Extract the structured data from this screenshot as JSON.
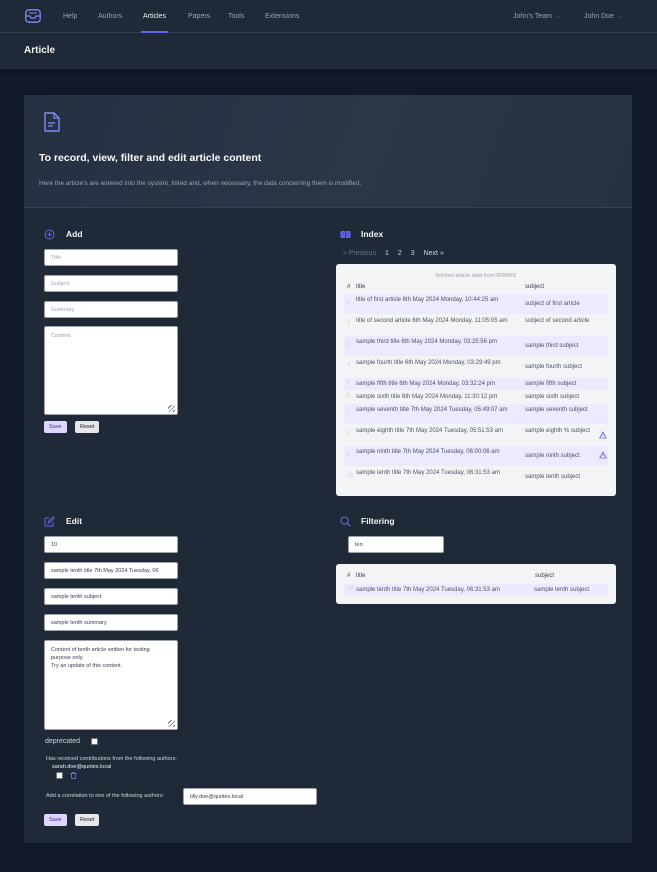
{
  "nav": {
    "items": [
      "Help",
      "Authors",
      "Articles",
      "Papers",
      "Tools",
      "Extensions"
    ],
    "active": "Articles",
    "team": "John's Team",
    "user": "John Doe"
  },
  "header": {
    "title": "Article"
  },
  "intro": {
    "title": "To record, view, filter and edit article content",
    "description": "Here the article's are entered into the system, listed and, when necessary, the data concerning them is modified."
  },
  "add": {
    "title": "Add",
    "title_placeholder": "Title",
    "subject_placeholder": "Subject",
    "summary_placeholder": "Summary",
    "content_placeholder": "Content",
    "save_label": "Save",
    "reset_label": "Reset"
  },
  "index": {
    "title": "Index",
    "prev": "« Previous",
    "pages": [
      "1",
      "2",
      "3"
    ],
    "next": "Next »",
    "caption": "fetched article data from RDBMS",
    "col_num": "#",
    "col_title": "title",
    "col_subject": "subject",
    "rows": [
      {
        "n": "1",
        "title": "title of first article 6th May 2024 Monday, 10:44:25 am",
        "subject": "subject of first article",
        "warn": false
      },
      {
        "n": "2",
        "title": "title of second article 6th May 2024 Monday, 11:05:05 am",
        "subject": "subject of second article",
        "warn": false
      },
      {
        "n": "3",
        "title": "sample third title 6th May 2024 Monday, 03:25:56 pm",
        "subject": "sample third subject",
        "warn": false
      },
      {
        "n": "4",
        "title": "sample fourth title 6th May 2024 Monday, 03:29:49 pm",
        "subject": "sample fourth subject",
        "warn": false
      },
      {
        "n": "5",
        "title": "sample fifth title 6th May 2024 Monday, 03:32:24 pm",
        "subject": "sample fifth subject",
        "warn": false
      },
      {
        "n": "6",
        "title": "sample sixth title 6th May 2024 Monday, 11:30:12 pm",
        "subject": "sample sixth subject",
        "warn": false
      },
      {
        "n": "7",
        "title": "sample seventh title 7th May 2024 Tuesday, 05:49:07 am",
        "subject": "sample seventh subject",
        "warn": false
      },
      {
        "n": "8",
        "title": "sample eighth title 7th May 2024 Tuesday, 05:51:53 am",
        "subject": "sample eighth % subject",
        "warn": true
      },
      {
        "n": "9",
        "title": "sample ninth title 7th May 2024 Tuesday, 06:00:06 am",
        "subject": "sample ninth subject",
        "warn": true
      },
      {
        "n": "10",
        "title": "sample tenth title 7th May 2024 Tuesday, 06:31:53 am",
        "subject": "sample tenth subject",
        "warn": false
      }
    ]
  },
  "edit": {
    "title": "Edit",
    "id_value": "10",
    "title_value": "sample tenth title 7th May 2024 Tuesday, 06",
    "subject_value": "sample tenth subject",
    "summary_value": "sample tenth summary",
    "content_line1": "Content of tenth article written for testing",
    "content_line2": "purpose only.",
    "content_line3": "Try an update of this content.",
    "deprecated_label": "deprecated",
    "contrib_label": "Has received contributions from the following authors:",
    "contrib_author": "sarah.doe@quotes.local",
    "correlation_label": "Add a correlation to one of the following authors:",
    "correlation_value": "tilly.doe@quotes.local",
    "save_label": "Save",
    "reset_label": "Reset"
  },
  "filtering": {
    "title": "Filtering",
    "query": "ten",
    "col_num": "#",
    "col_title": "title",
    "col_subject": "subject",
    "row_num": "10",
    "row_title": "sample tenth title 7th May 2024 Tuesday, 06:31:53 am",
    "row_subject": "sample tenth subject"
  },
  "colors": {
    "accent": "#6366f1",
    "bg": "#111827",
    "card": "#1f2937",
    "row_alt": "#ede9fe"
  }
}
